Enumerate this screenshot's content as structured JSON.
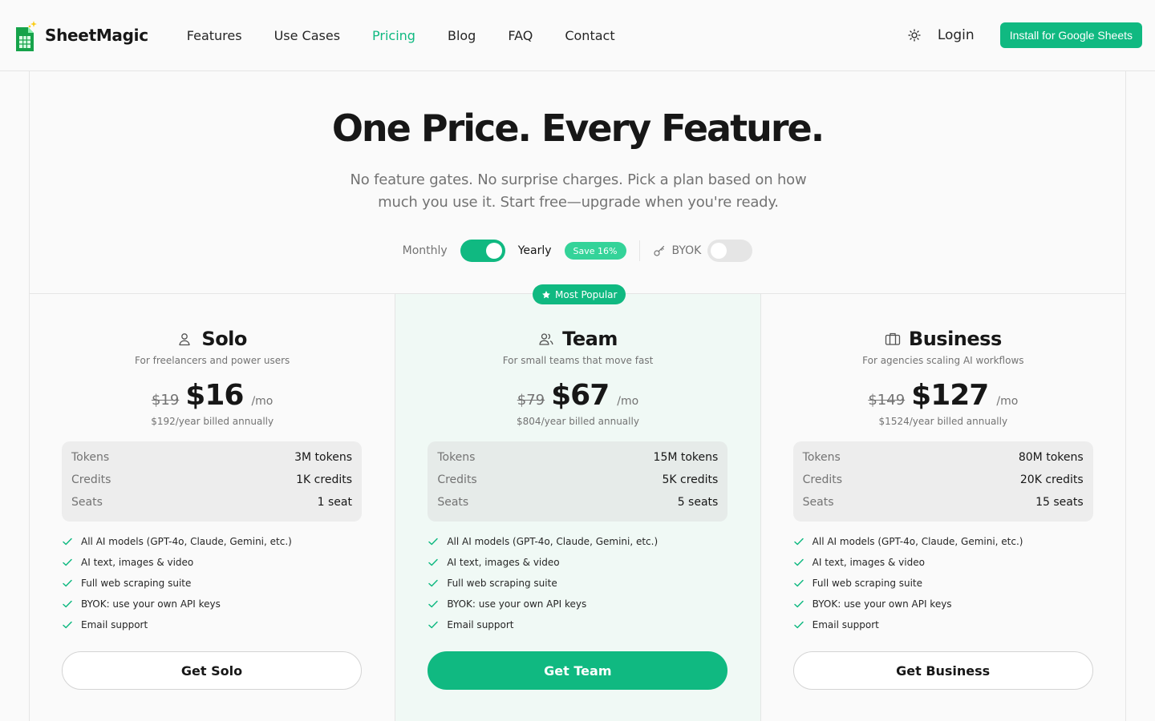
{
  "brand": {
    "name": "SheetMagic",
    "accent": "#10b981"
  },
  "nav": {
    "items": [
      {
        "label": "Features"
      },
      {
        "label": "Use Cases"
      },
      {
        "label": "Pricing",
        "active": true
      },
      {
        "label": "Blog"
      },
      {
        "label": "FAQ"
      },
      {
        "label": "Contact"
      }
    ]
  },
  "header": {
    "login_label": "Login",
    "install_label": "Install for Google Sheets",
    "theme_icon": "sun-icon"
  },
  "hero": {
    "title": "One Price. Every Feature.",
    "subtitle": "No feature gates. No surprise charges. Pick a plan based on how much you use it. Start free—upgrade when you're ready."
  },
  "billing": {
    "monthly_label": "Monthly",
    "yearly_label": "Yearly",
    "yearly_selected": true,
    "save_badge": "Save 16%",
    "byok_label": "BYOK",
    "byok_enabled": false
  },
  "popular_badge": "Most Popular",
  "plans": [
    {
      "name": "Solo",
      "icon": "user-icon",
      "tagline": "For freelancers and power users",
      "old_price": "$19",
      "price": "$16",
      "per": "/mo",
      "billed": "$192/year billed annually",
      "stats": [
        {
          "label": "Tokens",
          "value": "3M tokens"
        },
        {
          "label": "Credits",
          "value": "1K credits"
        },
        {
          "label": "Seats",
          "value": "1 seat"
        }
      ],
      "cta": "Get Solo"
    },
    {
      "name": "Team",
      "icon": "users-icon",
      "tagline": "For small teams that move fast",
      "old_price": "$79",
      "price": "$67",
      "per": "/mo",
      "billed": "$804/year billed annually",
      "stats": [
        {
          "label": "Tokens",
          "value": "15M tokens"
        },
        {
          "label": "Credits",
          "value": "5K credits"
        },
        {
          "label": "Seats",
          "value": "5 seats"
        }
      ],
      "cta": "Get Team"
    },
    {
      "name": "Business",
      "icon": "briefcase-icon",
      "tagline": "For agencies scaling AI workflows",
      "old_price": "$149",
      "price": "$127",
      "per": "/mo",
      "billed": "$1524/year billed annually",
      "stats": [
        {
          "label": "Tokens",
          "value": "80M tokens"
        },
        {
          "label": "Credits",
          "value": "20K credits"
        },
        {
          "label": "Seats",
          "value": "15 seats"
        }
      ],
      "cta": "Get Business"
    }
  ],
  "features": [
    "All AI models (GPT-4o, Claude, Gemini, etc.)",
    "AI text, images & video",
    "Full web scraping suite",
    "BYOK: use your own API keys",
    "Email support"
  ]
}
